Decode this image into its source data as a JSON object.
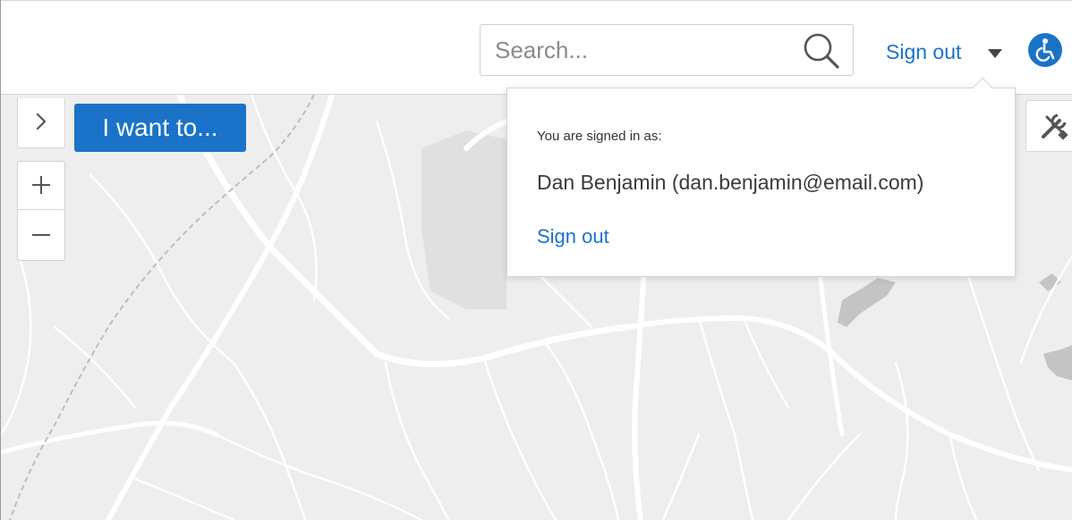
{
  "header": {
    "search_placeholder": "Search...",
    "signout_label": "Sign out"
  },
  "map_controls": {
    "i_want_to_label": "I want to...",
    "zoom_in_icon": "plus-icon",
    "zoom_out_icon": "minus-icon",
    "panel_toggle_icon": "chevron-right-icon",
    "tools_icon": "tools-icon"
  },
  "account_menu": {
    "signed_in_label": "You are signed in as:",
    "user": "Dan Benjamin (dan.benjamin@email.com)",
    "signout_label": "Sign out"
  },
  "colors": {
    "accent": "#1a73c8",
    "map_background": "#eeeeee",
    "map_roads": "#ffffff",
    "map_water": "#c4c4c4"
  }
}
